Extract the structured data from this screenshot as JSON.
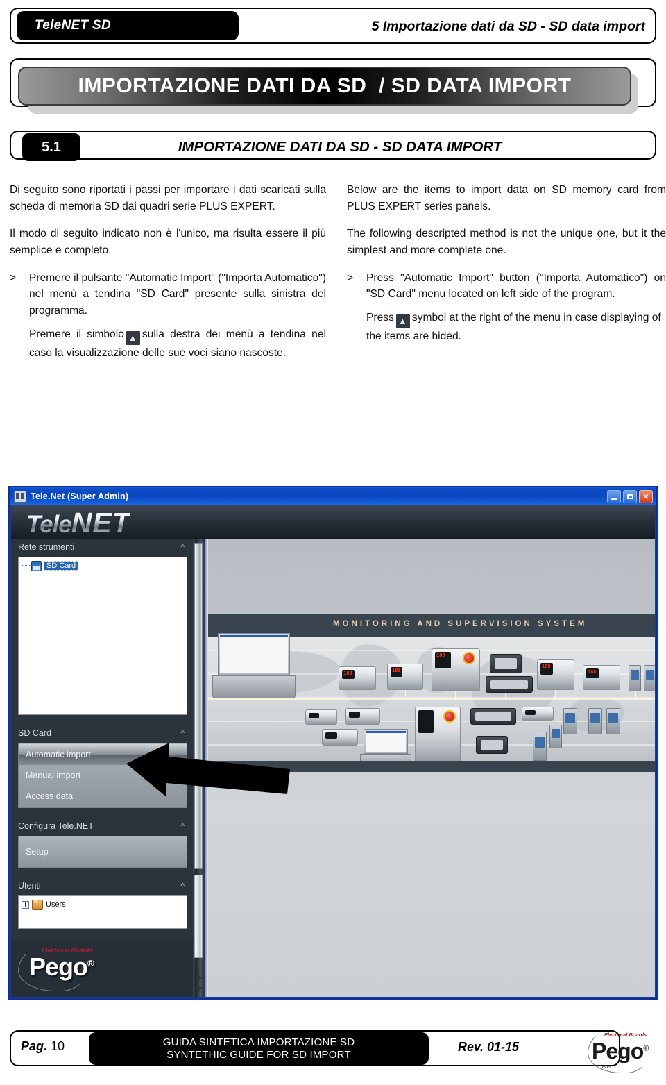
{
  "header": {
    "product_tag": "TeleNET SD",
    "chapter": "5 Importazione dati da SD - SD data import",
    "banner": "IMPORTAZIONE DATI DA SD  / SD DATA IMPORT",
    "section_number": "5.1",
    "section_title": "IMPORTAZIONE DATI DA SD - SD DATA IMPORT"
  },
  "left_column": {
    "p1": "Di seguito sono riportati i passi per importare i dati scaricati sulla scheda di memoria SD dai quadri serie PLUS EXPERT.",
    "p2": "Il modo di seguito indicato non è l'unico, ma risulta essere il più semplice e completo.",
    "bullet_marker": ">",
    "bullet1": "Premere il pulsante \"Automatic Import\" (\"Importa Automatico\") nel menù a tendina \"SD Card\" presente sulla sinistra del programma.",
    "sub_before": "Premere il simbolo",
    "sub_after": "sulla destra dei menù a tendina  nel caso la visualizzazione delle sue voci siano nascoste."
  },
  "right_column": {
    "p1": "Below are the items to import data on SD memory card from PLUS EXPERT series panels.",
    "p2": "The following descripted method is not the unique one, but it the simplest and more complete one.",
    "bullet_marker": ">",
    "bullet1": "Press \"Automatic Import\" button (\"Importa Automatico\") on \"SD Card\" menu located on left side of the program.",
    "sub_before": "Press",
    "sub_after": "symbol at the right of the menu in case displaying of the items are hided."
  },
  "app": {
    "titlebar": {
      "title": "Tele.Net (Super Admin)",
      "minimize_label": "_",
      "maximize_label": "□",
      "close_label": "✕"
    },
    "logo": {
      "prefix": "Tele",
      "suffix": "NET"
    },
    "sidebar": {
      "groups": [
        {
          "header": "Rete strumenti",
          "collapse_icon": "chevron-up",
          "tree_item": "SD Card"
        },
        {
          "header": "SD Card",
          "collapse_icon": "chevron-up",
          "items": [
            "Automatic import",
            "Manual import",
            "Access data"
          ],
          "selected": "Automatic import"
        },
        {
          "header": "Configura Tele.NET",
          "collapse_icon": "chevron-up",
          "items": [
            "Setup"
          ]
        },
        {
          "header": "Utenti",
          "collapse_icon": "chevron-up",
          "tree_item": "Users"
        }
      ],
      "brand": "Pego",
      "brand_tagline": "Electrical Boards",
      "brand_mark": "®"
    },
    "content": {
      "hero_caption": "MONITORING AND SUPERVISION SYSTEM"
    }
  },
  "footer": {
    "page_label": "Pag.",
    "page_number": "10",
    "title_it": "GUIDA SINTETICA IMPORTAZIONE SD",
    "title_en": "SYNTETHIC GUIDE FOR SD IMPORT",
    "revision": "Rev. 01-15",
    "brand": "Pego",
    "brand_tagline": "Electrical Boards",
    "brand_mark": "®"
  },
  "colors": {
    "accent_blue": "#0b4ec8",
    "sidebar_bg": "#2b333c",
    "black": "#000000",
    "brand_red": "#b02028"
  }
}
